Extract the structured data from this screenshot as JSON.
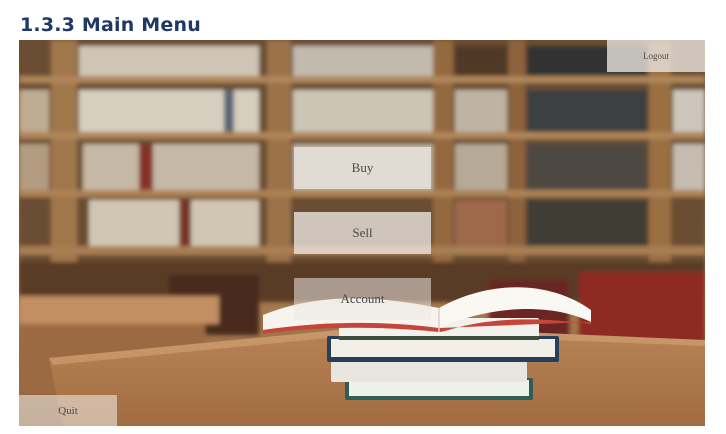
{
  "document": {
    "heading": "1.3.3 Main Menu"
  },
  "app": {
    "buttons": {
      "buy": "Buy",
      "sell": "Sell",
      "account": "Account",
      "logout": "Logout",
      "quit": "Quit"
    },
    "background": {
      "image_subject": "library-bookshelves-with-book-stack-icon"
    }
  }
}
